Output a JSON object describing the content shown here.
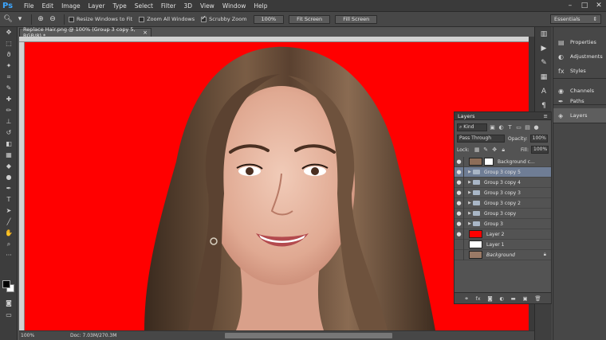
{
  "app": {
    "logo": "Ps",
    "menu": [
      "File",
      "Edit",
      "Image",
      "Layer",
      "Type",
      "Select",
      "Filter",
      "3D",
      "View",
      "Window",
      "Help"
    ],
    "window_controls": [
      "–",
      "□",
      "✕"
    ]
  },
  "options_bar": {
    "resize_windows": "Resize Windows to Fit",
    "zoom_all": "Zoom All Windows",
    "scrubby_zoom": "Scrubby Zoom",
    "zoom_value": "100%",
    "fit_screen": "Fit Screen",
    "fill_screen": "Fill Screen",
    "workspace": "Essentials"
  },
  "document": {
    "tab_title": "Replace Hair.png @ 100% (Group 3 copy 5, RGB/8) *",
    "canvas_color": "#ff0000",
    "status_zoom": "100%",
    "status_doc": "Doc: 7.03M/270.3M"
  },
  "right_panels": {
    "group1": [
      "Properties",
      "Adjustments",
      "Styles"
    ],
    "group2": [
      "Channels",
      "Paths"
    ],
    "group3": [
      "Layers"
    ]
  },
  "layers_panel": {
    "title": "Layers",
    "kind_label": "Kind",
    "blend_mode": "Pass Through",
    "opacity_label": "Opacity:",
    "opacity": "100%",
    "lock_label": "Lock:",
    "fill_label": "Fill:",
    "fill": "100%",
    "layers": [
      {
        "name": "Background c...",
        "type": "masked",
        "visible": true,
        "selected": false
      },
      {
        "name": "Group 3 copy 5",
        "type": "group",
        "visible": true,
        "selected": true
      },
      {
        "name": "Group 3 copy 4",
        "type": "group",
        "visible": true,
        "selected": false
      },
      {
        "name": "Group 3 copy 3",
        "type": "group",
        "visible": true,
        "selected": false
      },
      {
        "name": "Group 3 copy 2",
        "type": "group",
        "visible": true,
        "selected": false
      },
      {
        "name": "Group 3 copy",
        "type": "group",
        "visible": true,
        "selected": false
      },
      {
        "name": "Group 3",
        "type": "group",
        "visible": true,
        "selected": false
      },
      {
        "name": "Layer 2",
        "type": "fill",
        "color": "#ff0000",
        "visible": true,
        "selected": false
      },
      {
        "name": "Layer 1",
        "type": "fill",
        "color": "#ffffff",
        "visible": false,
        "selected": false
      },
      {
        "name": "Background",
        "type": "photo",
        "visible": false,
        "selected": false
      }
    ]
  }
}
